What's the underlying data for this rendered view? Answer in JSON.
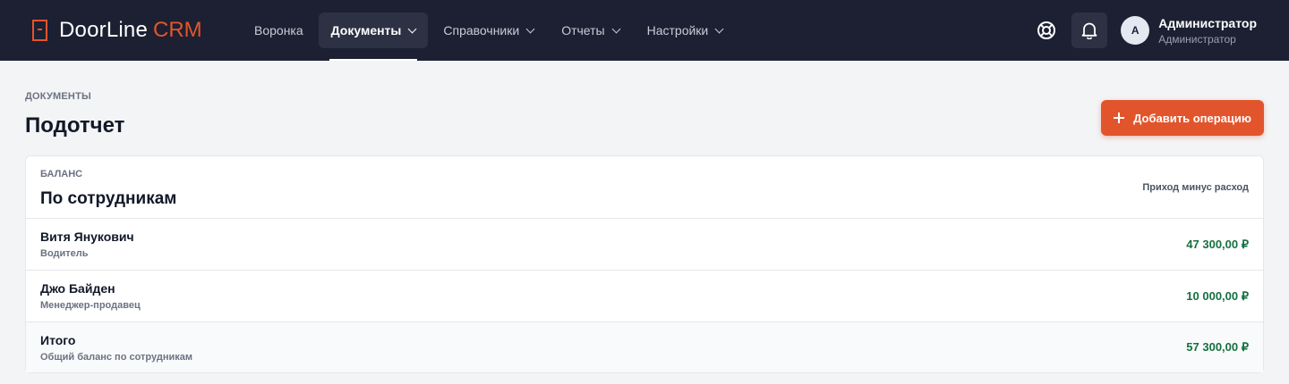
{
  "brand": {
    "name": "DoorLine",
    "accent": "CRM",
    "accent_color": "#e2552c"
  },
  "nav": [
    {
      "label": "Воронка",
      "active": false,
      "dropdown": false
    },
    {
      "label": "Документы",
      "active": true,
      "dropdown": true
    },
    {
      "label": "Справочники",
      "active": false,
      "dropdown": true
    },
    {
      "label": "Отчеты",
      "active": false,
      "dropdown": true
    },
    {
      "label": "Настройки",
      "active": false,
      "dropdown": true
    }
  ],
  "header_icons": {
    "help": "lifebuoy-icon",
    "notifications": "bell-icon"
  },
  "user": {
    "initial": "A",
    "name": "Администратор",
    "role": "Администратор"
  },
  "page": {
    "breadcrumb": "ДОКУМЕНТЫ",
    "title": "Подотчет",
    "add_button": "Добавить операцию"
  },
  "card": {
    "eyebrow": "БАЛАНС",
    "title": "По сотрудникам",
    "aside": "Приход минус расход",
    "rows": [
      {
        "name": "Витя Янукович",
        "role": "Водитель",
        "amount": "47 300,00 ₽"
      },
      {
        "name": "Джо Байден",
        "role": "Менеджер-продавец",
        "amount": "10 000,00 ₽"
      },
      {
        "name": "Итого",
        "role": "Общий баланс по сотрудникам",
        "amount": "57 300,00 ₽"
      }
    ]
  },
  "colors": {
    "topbar": "#1c2032",
    "accent": "#e2552c",
    "positive": "#15703f"
  }
}
